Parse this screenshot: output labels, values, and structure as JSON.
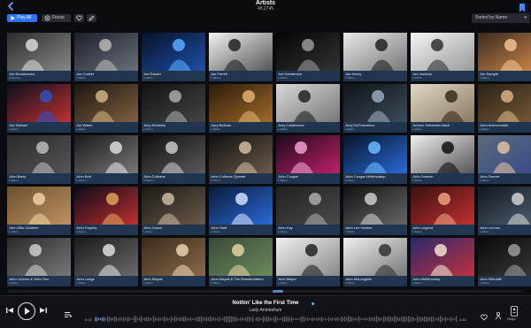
{
  "header": {
    "title": "Artists",
    "subtitle": "48,2745"
  },
  "toolbar": {
    "play_all_label": "Play All",
    "focus_label": "Focus",
    "sort_label": "Sorted by Name"
  },
  "tiles": [
    {
      "name": "Joe Bonamassa",
      "albums": "4 Albums"
    },
    {
      "name": "Joe Cocker",
      "albums": "1 Album"
    },
    {
      "name": "Joe Dassin",
      "albums": "1 Album"
    },
    {
      "name": "Joe Farrell",
      "albums": "1 Album"
    },
    {
      "name": "Joe Henderson",
      "albums": "1 Album"
    },
    {
      "name": "Joe Henry",
      "albums": "1 Album"
    },
    {
      "name": "Joe Jackson",
      "albums": "1 Album"
    },
    {
      "name": "Joe Sample",
      "albums": "1 Album"
    },
    {
      "name": "Joe Satriani",
      "albums": "1 Album"
    },
    {
      "name": "Joe Walsh",
      "albums": "1 Album"
    },
    {
      "name": "Joey McNeely",
      "albums": "1 Album"
    },
    {
      "name": "Joey Beltram",
      "albums": "1 Album"
    },
    {
      "name": "Joey Calderazzo",
      "albums": "1 Album"
    },
    {
      "name": "Joey DeFrancesco",
      "albums": "1 Album"
    },
    {
      "name": "Johann Sebastian Bach",
      "albums": "1 Album"
    },
    {
      "name": "John Abercrombie",
      "albums": "1 Album"
    },
    {
      "name": "John Barry",
      "albums": "1 Album"
    },
    {
      "name": "John Butt",
      "albums": "1 Album"
    },
    {
      "name": "John Coltrane",
      "albums": "4 Albums"
    },
    {
      "name": "John Coltrane Quartet",
      "albums": "1 Album"
    },
    {
      "name": "John Cougar",
      "albums": "1 Album"
    },
    {
      "name": "John Cougar Mellencamp",
      "albums": "1 Album"
    },
    {
      "name": "John Deacon",
      "albums": "1 Album"
    },
    {
      "name": "John Denver",
      "albums": "1 Album"
    },
    {
      "name": "John Ellis Gardiner",
      "albums": "1 Album"
    },
    {
      "name": "John Fogerty",
      "albums": "1 Album"
    },
    {
      "name": "John Gorka",
      "albums": "1 Album"
    },
    {
      "name": "John Hiatt",
      "albums": "1 Album"
    },
    {
      "name": "John Kay",
      "albums": "1 Album"
    },
    {
      "name": "John Lee Hooker",
      "albums": "1 Album"
    },
    {
      "name": "John Legend",
      "albums": "1 Album"
    },
    {
      "name": "John Lennon",
      "albums": "1 Album"
    },
    {
      "name": "John Lennon & Yoko Ono",
      "albums": "1 Album"
    },
    {
      "name": "John Lodge",
      "albums": "1 Album"
    },
    {
      "name": "John Mayall",
      "albums": "1 Album"
    },
    {
      "name": "John Mayall & The Bluesbreakers",
      "albums": "1 Album"
    },
    {
      "name": "John Mayer",
      "albums": "1 Album"
    },
    {
      "name": "John McLaughlin",
      "albums": "1 Album"
    },
    {
      "name": "John Mellencamp",
      "albums": "1 Album"
    },
    {
      "name": "John Metcalfe",
      "albums": "1 Album"
    }
  ],
  "player": {
    "track": "Nothin' Like the First Time",
    "artist": "Lady Antebellum",
    "elapsed": "0:02",
    "duration": "3:44",
    "progress": 0.03,
    "device_label": "Hugo"
  },
  "colors": {
    "accent": "#2c74ff",
    "label_bg": "#1f3550"
  }
}
